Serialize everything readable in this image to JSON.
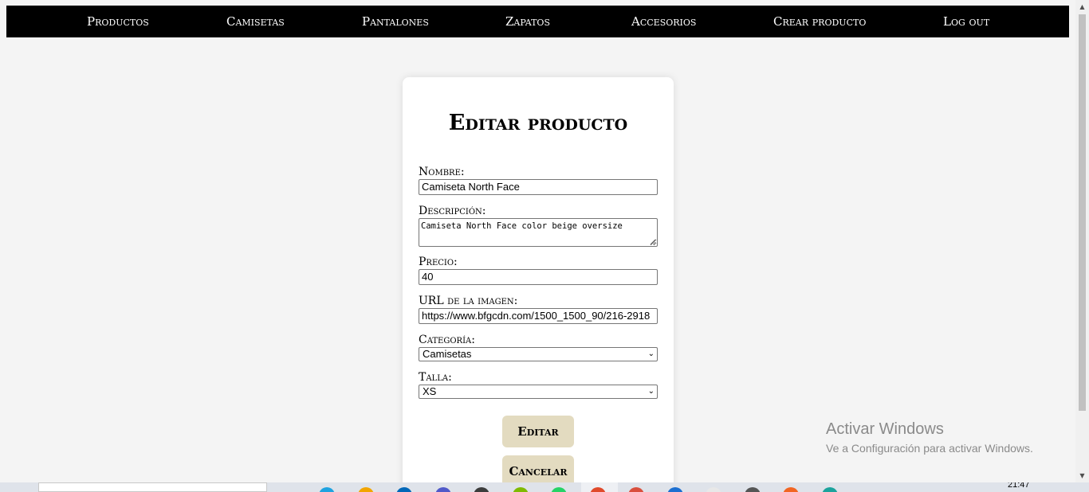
{
  "nav": {
    "items": [
      "Productos",
      "Camisetas",
      "Pantalones",
      "Zapatos",
      "Accesorios",
      "Crear producto",
      "Log out"
    ]
  },
  "form": {
    "title": "Editar producto",
    "nombre_label": "Nombre:",
    "nombre_value": "Camiseta North Face",
    "descripcion_label": "Descripción:",
    "descripcion_value": "Camiseta North Face color beige oversize",
    "precio_label": "Precio:",
    "precio_value": "40",
    "url_label": "URL de la imagen:",
    "url_value": "https://www.bfgcdn.com/1500_1500_90/216-2918",
    "categoria_label": "Categoría:",
    "categoria_value": "Camisetas",
    "talla_label": "Talla:",
    "talla_value": "XS",
    "editar_button": "Editar",
    "cancelar_button": "Cancelar"
  },
  "watermark": {
    "title": "Activar Windows",
    "subtitle": "Ve a Configuración para activar Windows."
  },
  "taskbar": {
    "clock": "21:47",
    "icon_colors": [
      "#1fa3e0",
      "#f2a500",
      "#0067b8",
      "#5059c9",
      "#3c3c3c",
      "#7fba00",
      "#25d366",
      "#e04a2b",
      "#d94f3d",
      "#1c6fd1",
      "#e8e8e8",
      "#555555",
      "#f26522",
      "#1ba39c"
    ]
  },
  "colors": {
    "navbar_bg": "#000000",
    "page_bg": "#f4f4f4",
    "button_bg": "#e3dbc0"
  }
}
